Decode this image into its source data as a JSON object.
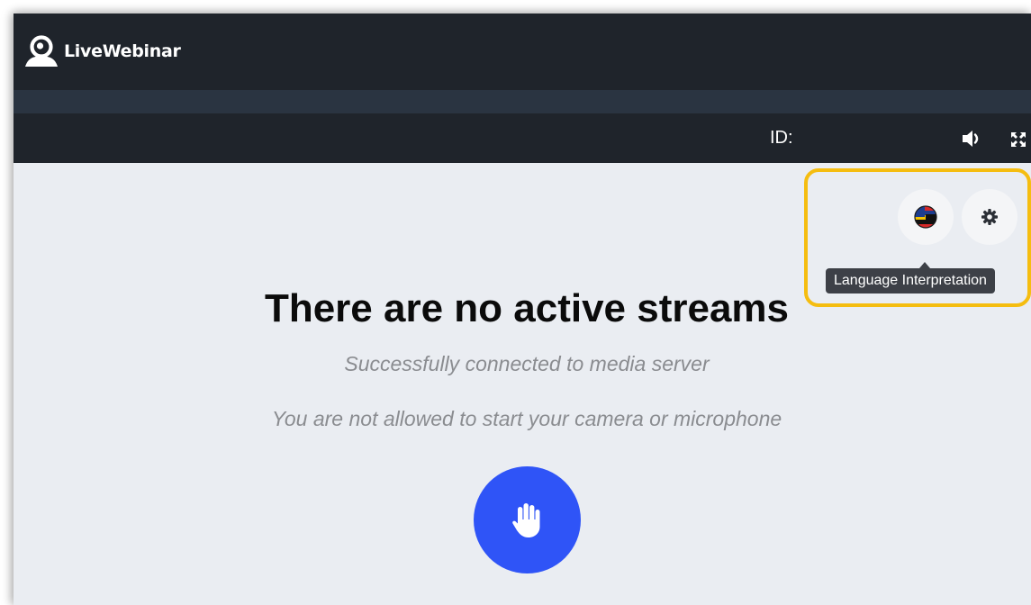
{
  "app": {
    "logo_text": "LiveWebinar"
  },
  "infobar": {
    "id_label": "ID:",
    "volume_icon": "volume-icon",
    "fullscreen_icon": "fullscreen-icon"
  },
  "controls": {
    "language_button_icon": "language-flags-icon",
    "settings_button_icon": "gear-icon",
    "tooltip_text": "Language Interpretation",
    "highlight_color": "#f5bd10"
  },
  "main": {
    "headline": "There are no active streams",
    "status_line": "Successfully connected to media server",
    "permission_line": "You are not allowed to start your camera or microphone",
    "raise_hand_icon": "hand-icon",
    "accent_color": "#2f54f7"
  }
}
